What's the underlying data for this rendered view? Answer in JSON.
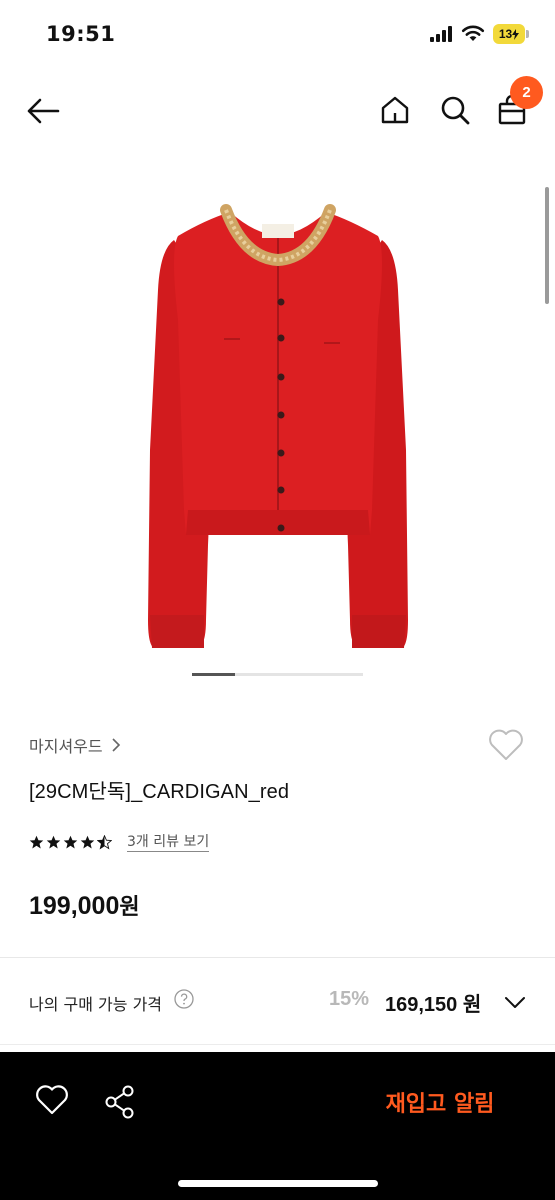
{
  "status_bar": {
    "time": "19:51",
    "battery": "13"
  },
  "nav": {
    "cart_count": "2",
    "icons": [
      "back-arrow-icon",
      "home-icon",
      "search-icon",
      "shopping-bag-icon"
    ]
  },
  "product": {
    "brand": "마지셔우드",
    "title": "[29CM단독]_CARDIGAN_red",
    "rating": 4.5,
    "review_link": "3개 리뷰 보기",
    "price": "199,000",
    "price_unit": "원",
    "image_colors": {
      "cardigan": "#d91c1f",
      "trim": "#c9a25a"
    },
    "gallery_position": 1,
    "gallery_total": 4
  },
  "purchase": {
    "label": "나의 구매 가능 가격",
    "discount": "15%",
    "sale_price": "169,150 원"
  },
  "bottom_bar": {
    "restock_label": "재입고 알림"
  },
  "colors": {
    "accent": "#ff5a1f",
    "bottom_bar": "#000000"
  }
}
